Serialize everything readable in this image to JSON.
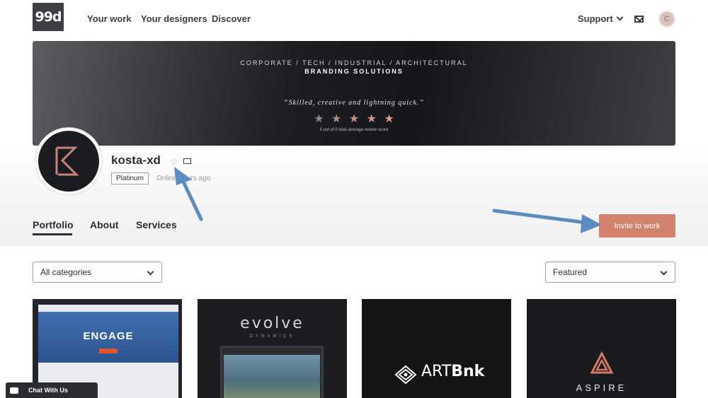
{
  "nav": {
    "logo": "99d",
    "links": [
      "Your work",
      "Your designers",
      "Discover"
    ],
    "support": "Support",
    "avatar_initial": "C"
  },
  "banner": {
    "line1": "CORPORATE / TECH / INDUSTRIAL / ARCHITECTURAL",
    "line2": "BRANDING SOLUTIONS",
    "quote": "“Skilled, creative and lightning quick.”",
    "stars": [
      "★",
      "★",
      "★",
      "★",
      "★"
    ],
    "score_text": "5 out of 5 total average review score",
    "star_colors": [
      "#8a8a8a",
      "#b08b86",
      "#c69289",
      "#d9958a",
      "#e29a8d"
    ]
  },
  "profile": {
    "username": "kosta-xd",
    "badge": "Platinum",
    "online": "Online hours ago",
    "heart_icon": "heart-icon",
    "message_icon": "envelope-icon"
  },
  "tabs": [
    "Portfolio",
    "About",
    "Services"
  ],
  "invite_button": "Invite to work",
  "filters": {
    "categories": "All categories",
    "sort": "Featured"
  },
  "tiles": {
    "t1_title": "ENGAGE",
    "t2_title": "evolve",
    "t2_sub": "DYNAMICS",
    "t3_logo_light": "ART",
    "t3_logo_bold": "Bnk",
    "t4_name": "ASPIRE"
  },
  "chat": {
    "label": "Chat With Us"
  },
  "colors": {
    "accent": "#d3836d",
    "arrow": "#5b8bc0"
  }
}
